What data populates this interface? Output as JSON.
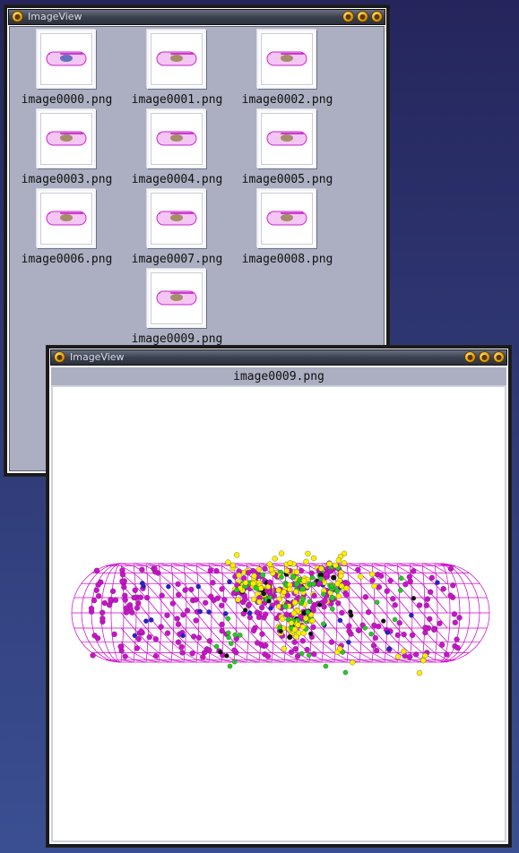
{
  "gallery_window": {
    "title": "ImageView",
    "thumbnails": [
      {
        "label": "image0000.png"
      },
      {
        "label": "image0001.png"
      },
      {
        "label": "image0002.png"
      },
      {
        "label": "image0003.png"
      },
      {
        "label": "image0004.png"
      },
      {
        "label": "image0005.png"
      },
      {
        "label": "image0006.png"
      },
      {
        "label": "image0007.png"
      },
      {
        "label": "image0008.png"
      },
      {
        "label": "image0009.png"
      }
    ]
  },
  "viewer_window": {
    "title": "ImageView",
    "filename": "image0009.png"
  },
  "colors": {
    "capsule_mesh": "#cc00cc",
    "particle_magenta": "#cc11cc",
    "particle_yellow": "#ffee00",
    "particle_green": "#22cc22",
    "particle_blue": "#2222cc",
    "particle_black": "#111111"
  },
  "icons": {
    "window_menu": "window-menu-icon",
    "minimize": "minimize-icon",
    "maximize": "maximize-icon",
    "close": "close-icon"
  }
}
